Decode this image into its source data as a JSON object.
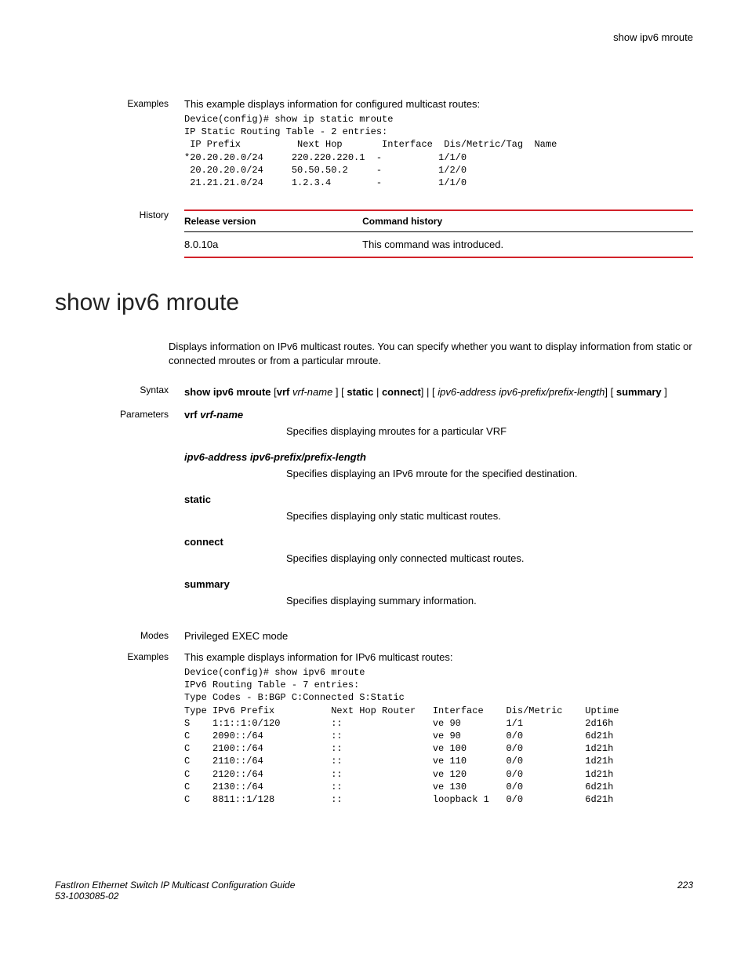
{
  "header": {
    "right": "show ipv6 mroute"
  },
  "examples1": {
    "label": "Examples",
    "intro": "This example displays information for configured multicast routes:",
    "code": "Device(config)# show ip static mroute\nIP Static Routing Table - 2 entries:\n IP Prefix          Next Hop       Interface  Dis/Metric/Tag  Name\n*20.20.20.0/24     220.220.220.1  -          1/1/0\n 20.20.20.0/24     50.50.50.2     -          1/2/0\n 21.21.21.0/24     1.2.3.4        -          1/1/0"
  },
  "history": {
    "label": "History",
    "col1": "Release version",
    "col2": "Command history",
    "row_version": "8.0.10a",
    "row_desc": "This command was introduced."
  },
  "command_title": "show ipv6 mroute",
  "command_intro": "Displays information on IPv6 multicast routes. You can specify whether you want to display information from static or connected mroutes or from a particular mroute.",
  "syntax": {
    "label": "Syntax",
    "parts": {
      "cmd": "show ipv6 mroute",
      "vrf": "vrf",
      "vrfname": "vrf-name",
      "static": "static",
      "connect": "connect",
      "addr": "ipv6-address ipv6-prefix/prefix-length",
      "summary": "summary"
    }
  },
  "parameters": {
    "label": "Parameters",
    "items": [
      {
        "name_bold": "vrf",
        "name_italic": "vrf-name",
        "desc": "Specifies displaying mroutes for a particular VRF"
      },
      {
        "name_bold": "",
        "name_italic": "ipv6-address ipv6-prefix/prefix-length",
        "desc": "Specifies displaying an IPv6 mroute for the specified destination."
      },
      {
        "name_bold": "static",
        "name_italic": "",
        "desc": "Specifies displaying only static multicast routes."
      },
      {
        "name_bold": "connect",
        "name_italic": "",
        "desc": "Specifies displaying only connected multicast routes."
      },
      {
        "name_bold": "summary",
        "name_italic": "",
        "desc": "Specifies displaying summary information."
      }
    ]
  },
  "modes": {
    "label": "Modes",
    "text": "Privileged EXEC mode"
  },
  "examples2": {
    "label": "Examples",
    "intro": "This example displays information for IPv6 multicast routes:",
    "code": "Device(config)# show ipv6 mroute\nIPv6 Routing Table - 7 entries:\nType Codes - B:BGP C:Connected S:Static\nType IPv6 Prefix          Next Hop Router   Interface    Dis/Metric    Uptime\nS    1:1::1:0/120         ::                ve 90        1/1           2d16h\nC    2090::/64            ::                ve 90        0/0           6d21h\nC    2100::/64            ::                ve 100       0/0           1d21h\nC    2110::/64            ::                ve 110       0/0           1d21h\nC    2120::/64            ::                ve 120       0/0           1d21h\nC    2130::/64            ::                ve 130       0/0           6d21h\nC    8811::1/128          ::                loopback 1   0/0           6d21h"
  },
  "footer": {
    "left1": "FastIron Ethernet Switch IP Multicast Configuration Guide",
    "left2": "53-1003085-02",
    "right": "223"
  }
}
